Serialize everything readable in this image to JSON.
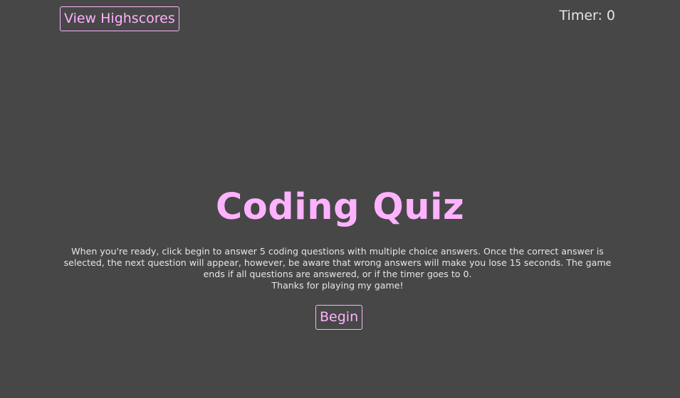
{
  "header": {
    "highscores_label": "View Highscores",
    "timer_label": "Timer:",
    "timer_value": "0"
  },
  "main": {
    "title": "Coding Quiz",
    "instructions": "When you're ready, click begin to answer 5 coding questions with multiple choice answers. Once the correct answer is selected, the next question will appear, however, be aware that wrong answers will make you lose 15 seconds. The game ends if all questions are answered, or if the timer goes to 0.",
    "thanks": "Thanks for playing my game!",
    "begin_label": "Begin"
  },
  "colors": {
    "background": "#474747",
    "accent": "#ffb3ff",
    "text": "#e6e6e6"
  }
}
